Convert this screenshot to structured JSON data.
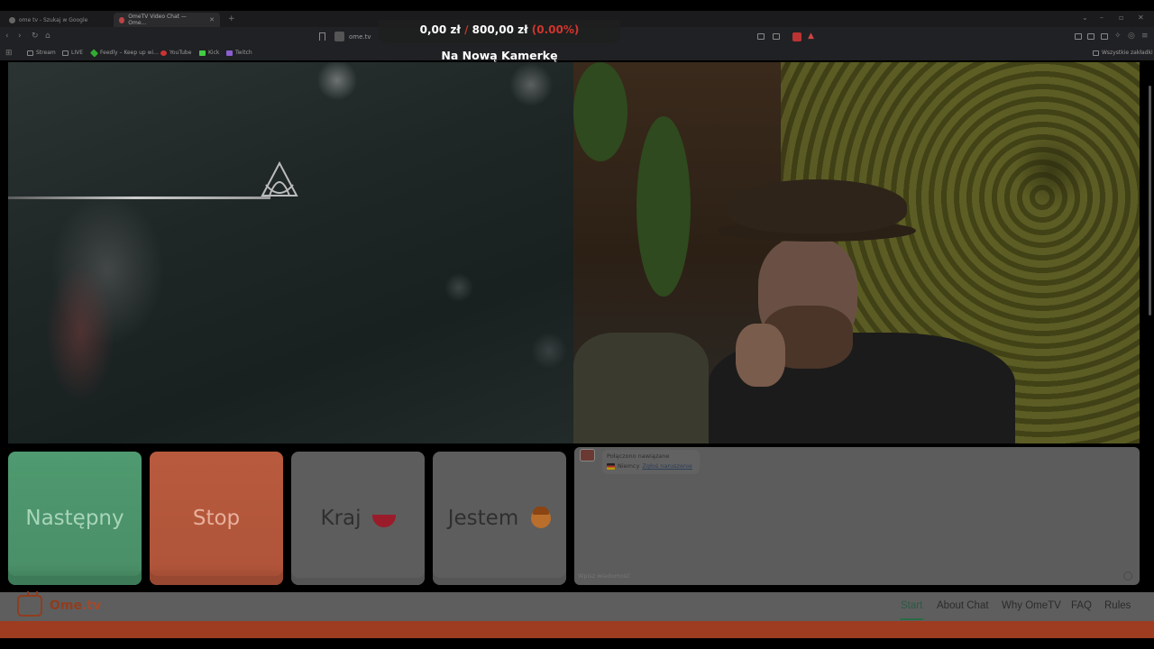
{
  "browser": {
    "tabs": [
      {
        "label": "ome tv - Szukaj w Google"
      },
      {
        "label": "OmeTV Video Chat — Ome..."
      }
    ],
    "url": "ome.tv",
    "bookmarks": [
      "Stream",
      "LIVE",
      "Feedly – Keep up wi...",
      "YouTube",
      "Kick",
      "Twitch"
    ],
    "bookmarks_right": "Wszystkie zakładki"
  },
  "overlay": {
    "current": "0,00 zł",
    "separator": "/",
    "goal": "800,00 zł",
    "percent": "(0.00%)",
    "title": "Na Nową Kamerkę"
  },
  "controls": {
    "next": "Następny",
    "stop": "Stop",
    "country": "Kraj",
    "gender": "Jestem"
  },
  "chat": {
    "status": "Połączono nawiązane",
    "country": "Niemcy",
    "report_link": "Zgłoś naruszenie",
    "input_placeholder": "Wpisz wiadomość"
  },
  "footer": {
    "logo": "Ome",
    "logo_suffix": ".tv",
    "links": [
      "Start",
      "About Chat",
      "Why OmeTV",
      "FAQ",
      "Rules"
    ],
    "active_link": "Start"
  },
  "colors": {
    "next_button": "#4f9a70",
    "stop_button": "#b85a3d",
    "brand": "#8f3d1e",
    "goal_red": "#d0352e"
  }
}
